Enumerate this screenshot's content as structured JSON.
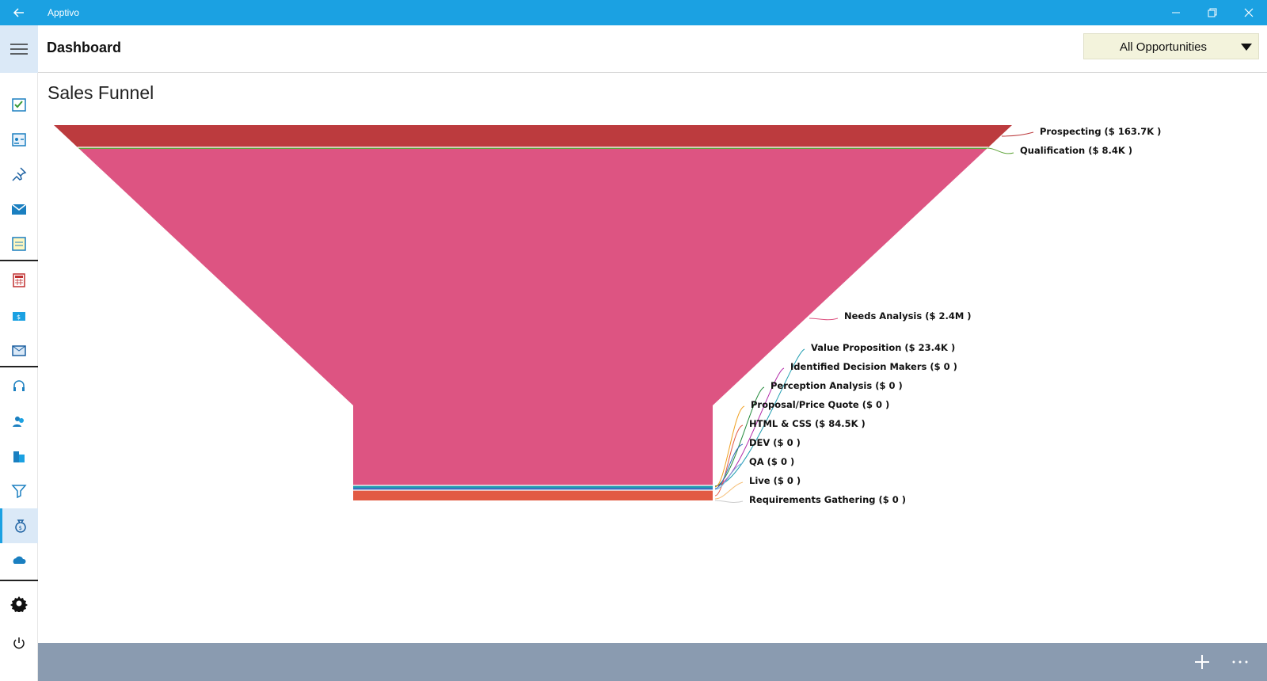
{
  "window": {
    "title": "Apptivo"
  },
  "header": {
    "title": "Dashboard",
    "filter_value": "All Opportunities"
  },
  "sidebar": {
    "items": [
      {
        "icon": "calendar-task-icon",
        "active": false
      },
      {
        "icon": "contact-card-icon",
        "active": false
      },
      {
        "icon": "pin-icon",
        "active": false
      },
      {
        "icon": "mail-icon",
        "active": false
      },
      {
        "icon": "notes-icon",
        "active": false
      },
      {
        "icon": "calculator-icon",
        "active": false
      },
      {
        "icon": "dollar-wallet-icon",
        "active": false
      },
      {
        "icon": "email-campaign-icon",
        "active": false
      },
      {
        "icon": "headset-icon",
        "active": false
      },
      {
        "icon": "users-icon",
        "active": false
      },
      {
        "icon": "buildings-icon",
        "active": false
      },
      {
        "icon": "funnel-icon",
        "active": true
      },
      {
        "icon": "money-bag-icon",
        "active": false
      },
      {
        "icon": "cloud-icon",
        "active": false
      },
      {
        "icon": "gear-icon",
        "active": false
      },
      {
        "icon": "power-icon",
        "active": false
      }
    ]
  },
  "chart_data": {
    "type": "funnel",
    "title": "Sales Funnel",
    "stages": [
      {
        "name": "Prospecting",
        "label": "Prospecting ($ 163.7K )",
        "value": 163700,
        "color": "#bc3b3e"
      },
      {
        "name": "Qualification",
        "label": "Qualification ($ 8.4K )",
        "value": 8400,
        "color": "#5fa53a"
      },
      {
        "name": "Needs Analysis",
        "label": "Needs Analysis ($ 2.4M )",
        "value": 2400000,
        "color": "#dd5482"
      },
      {
        "name": "Value Proposition",
        "label": "Value Proposition ($ 23.4K )",
        "value": 23400,
        "color": "#1f9db0"
      },
      {
        "name": "Identified Decision Makers",
        "label": "Identified Decision Makers ($ 0 )",
        "value": 0,
        "color": "#b22aa8"
      },
      {
        "name": "Perception Analysis",
        "label": "Perception Analysis ($ 0 )",
        "value": 0,
        "color": "#238a3c"
      },
      {
        "name": "Proposal/Price Quote",
        "label": "Proposal/Price Quote ($ 0 )",
        "value": 0,
        "color": "#f0a020"
      },
      {
        "name": "HTML & CSS",
        "label": "HTML & CSS ($ 84.5K )",
        "value": 84500,
        "color": "#e25a43"
      },
      {
        "name": "DEV",
        "label": "DEV ($ 0 )",
        "value": 0,
        "color": "#3a6fc0"
      },
      {
        "name": "QA",
        "label": "QA ($ 0 )",
        "value": 0,
        "color": "#7ab6e0"
      },
      {
        "name": "Live",
        "label": "Live ($ 0 )",
        "value": 0,
        "color": "#f5c07a"
      },
      {
        "name": "Requirements Gathering",
        "label": "Requirements Gathering ($ 0 )",
        "value": 0,
        "color": "#cccccc"
      }
    ]
  },
  "bottombar": {
    "add_icon": "plus-icon",
    "more_icon": "more-icon"
  }
}
